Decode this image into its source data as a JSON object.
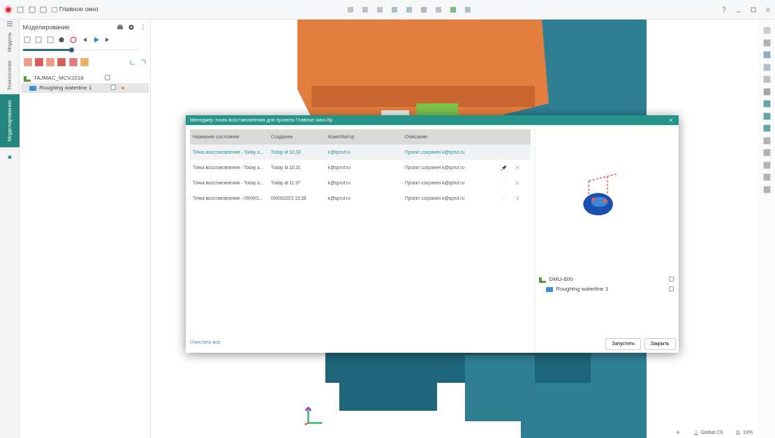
{
  "window": {
    "title": "Главное окно"
  },
  "left_tabs": [
    {
      "label": "Модель",
      "selected": false
    },
    {
      "label": "Технология",
      "selected": false
    },
    {
      "label": "Моделирование",
      "selected": true
    }
  ],
  "panel": {
    "title": "Моделирование",
    "slider": {
      "level": 0.42
    },
    "tree": [
      {
        "label": "TAJMAC_MCV2218",
        "selected": false,
        "children": [
          {
            "label": "Roughing waterline 1",
            "selected": true
          }
        ]
      }
    ]
  },
  "dialog": {
    "title": "Менеджер точек восстановления для проекта Главное окно.ttp",
    "columns": [
      "Название состояния",
      "Создание",
      "Комп/Автор",
      "Описание"
    ],
    "rows": [
      {
        "cells": [
          "Точка восстановления - Today a...",
          "Today at 10:33",
          "k@sprut.ru",
          "Проект сохранен k@sprut.ru"
        ],
        "selected": true,
        "pinned": false,
        "removable": false
      },
      {
        "cells": [
          "Точка восстановления - Today a...",
          "Today at 10:31",
          "k@sprut.ru",
          "Проект сохранен k@sprut.ru"
        ],
        "selected": false,
        "pinned": true,
        "removable": true
      },
      {
        "cells": [
          "Точка восстановления - Today a...",
          "Today at 11:37",
          "k@sprut.ru",
          "Проект сохранен k@sprut.ru"
        ],
        "selected": false,
        "pinned": false,
        "removable": true
      },
      {
        "cells": [
          "Точка восстановления - 09/09/2...",
          "09/09/2023 15:38",
          "k@sprut.ru",
          "Проект сохранен k@sprut.ru"
        ],
        "selected": false,
        "pinned": false,
        "removable": true
      }
    ],
    "preview_tree": [
      {
        "label": "DMU-600",
        "children": [
          {
            "label": "Roughing waterline 1"
          }
        ]
      }
    ],
    "clear_link": "Очистить все",
    "buttons": [
      "Запустить",
      "Закрыть"
    ]
  },
  "status_bar": {
    "coordinate_system": "Global CS",
    "zoom": "19%"
  }
}
